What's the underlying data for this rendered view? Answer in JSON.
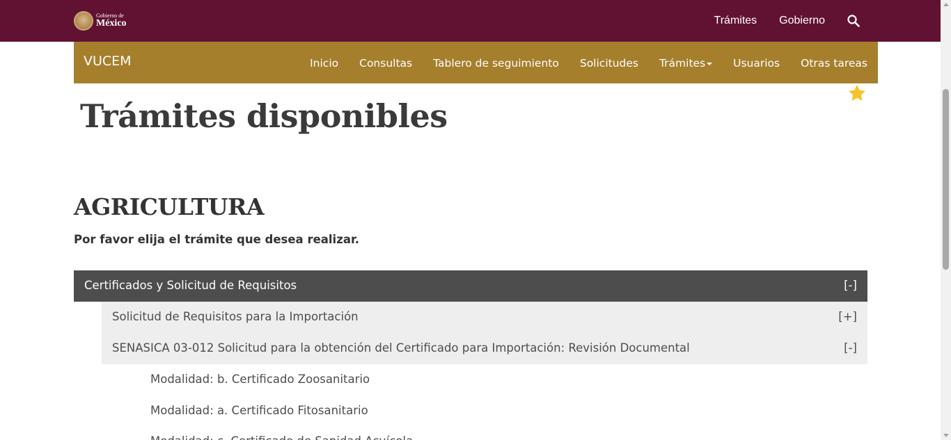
{
  "gov_header": {
    "logo_small": "Gobierno de",
    "logo_big": "México",
    "nav": [
      "Trámites",
      "Gobierno"
    ],
    "search_icon": "search-icon"
  },
  "vucem": {
    "brand": "VUCEM",
    "nav": {
      "inicio": "Inicio",
      "consultas": "Consultas",
      "tablero": "Tablero de seguimiento",
      "solicitudes": "Solicitudes",
      "tramites": "Trámites",
      "usuarios": "Usuarios",
      "otras": "Otras tareas"
    }
  },
  "favorite_icon": "star-icon",
  "favorite_color": "#f6c22b",
  "page": {
    "title": "Trámites disponibles",
    "section": "AGRICULTURA",
    "instruction": "Por favor elija el trámite que desea realizar."
  },
  "accordion": {
    "header": {
      "label": "Certificados y Solicitud de Requisitos",
      "toggle": "[-]"
    },
    "subs": [
      {
        "label": "Solicitud de Requisitos para la Importación",
        "toggle": "[+]"
      },
      {
        "label": "SENASICA 03-012 Solicitud para la obtención del Certificado para Importación: Revisión Documental",
        "toggle": "[-]"
      }
    ],
    "modalities": [
      "Modalidad: b. Certificado Zoosanitario",
      "Modalidad: a. Certificado Fitosanitario",
      "Modalidad: c. Certificado de Sanidad Acuícola"
    ]
  },
  "colors": {
    "gov_bar": "#611232",
    "vucem_bar": "#a57f2c",
    "accordion_header": "#4d4d4d",
    "accordion_sub": "#eeeeee"
  }
}
